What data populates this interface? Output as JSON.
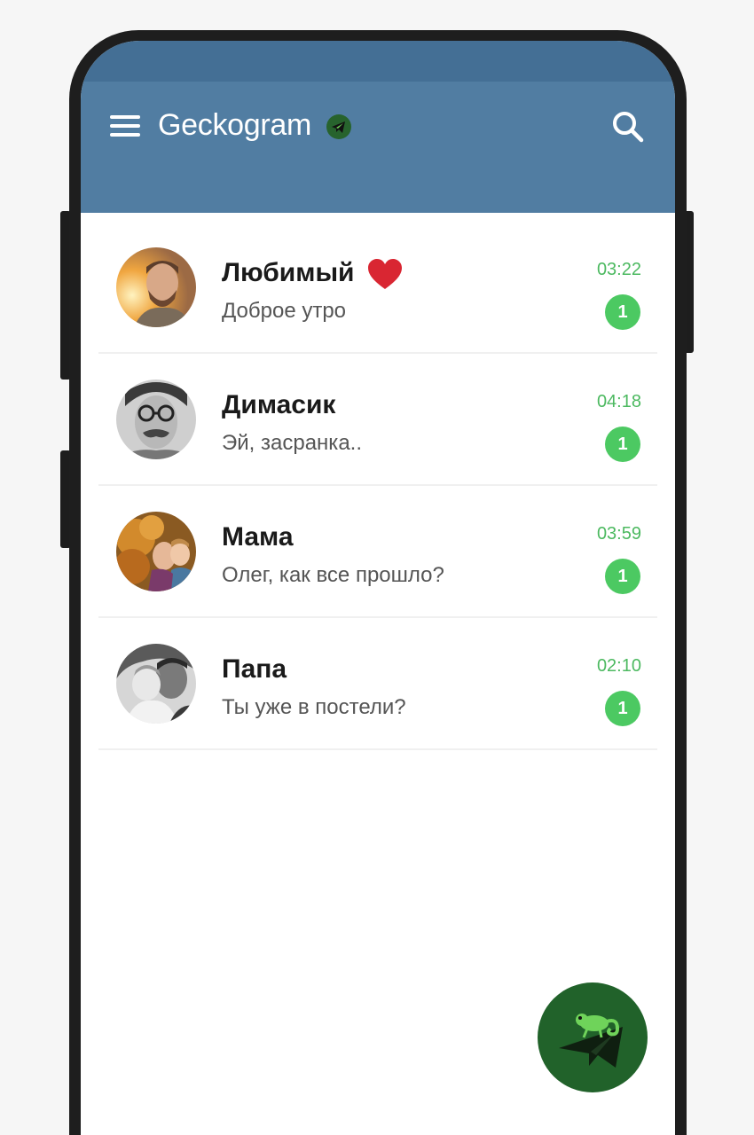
{
  "app": {
    "title": "Geckogram"
  },
  "colors": {
    "header": "#517da2",
    "statusbar": "#446f95",
    "accent_green": "#4cc962",
    "time_green": "#4cb960",
    "fab": "#21622a"
  },
  "icons": {
    "menu": "hamburger-menu-icon",
    "search": "search-icon",
    "title_badge": "telegram-badge-icon",
    "heart": "heart-icon",
    "fab": "gecko-compose-icon"
  },
  "chats": [
    {
      "name": "Любимый",
      "preview": "Доброе утро",
      "time": "03:22",
      "unread": "1",
      "has_heart": true
    },
    {
      "name": "Димасик",
      "preview": "Эй, засранка..",
      "time": "04:18",
      "unread": "1",
      "has_heart": false
    },
    {
      "name": "Мама",
      "preview": "Олег, как все прошло?",
      "time": "03:59",
      "unread": "1",
      "has_heart": false
    },
    {
      "name": "Папа",
      "preview": "Ты уже в постели?",
      "time": "02:10",
      "unread": "1",
      "has_heart": false
    }
  ]
}
